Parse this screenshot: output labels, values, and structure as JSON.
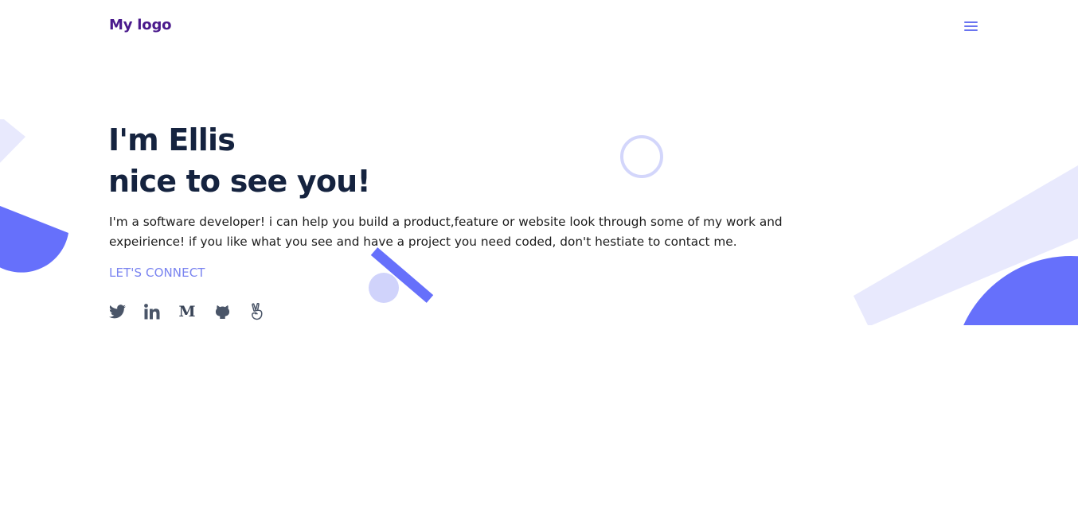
{
  "header": {
    "logo": "My logo",
    "menu_icon": "hamburger-menu-icon"
  },
  "hero": {
    "title_line_1": "I'm Ellis",
    "title_line_2": "nice to see you!",
    "intro": "I'm a software developer! i can help you build a product,feature or website look through some of my work and expeirience! if you like what you see and have a project you need coded, don't hestiate to contact me.",
    "cta_label": "LET'S CONNECT"
  },
  "socials": [
    {
      "icon": "twitter-icon"
    },
    {
      "icon": "linkedin-icon"
    },
    {
      "icon": "medium-icon",
      "glyph": "M"
    },
    {
      "icon": "github-icon"
    },
    {
      "icon": "angellist-icon"
    }
  ],
  "colors": {
    "logo": "#4a1a8c",
    "heading": "#15233f",
    "accent": "#6a74f0",
    "link": "#7a84f0",
    "decor_light": "#e8e9fd",
    "decor_solid": "#6670fb",
    "icon": "#4a5568"
  }
}
